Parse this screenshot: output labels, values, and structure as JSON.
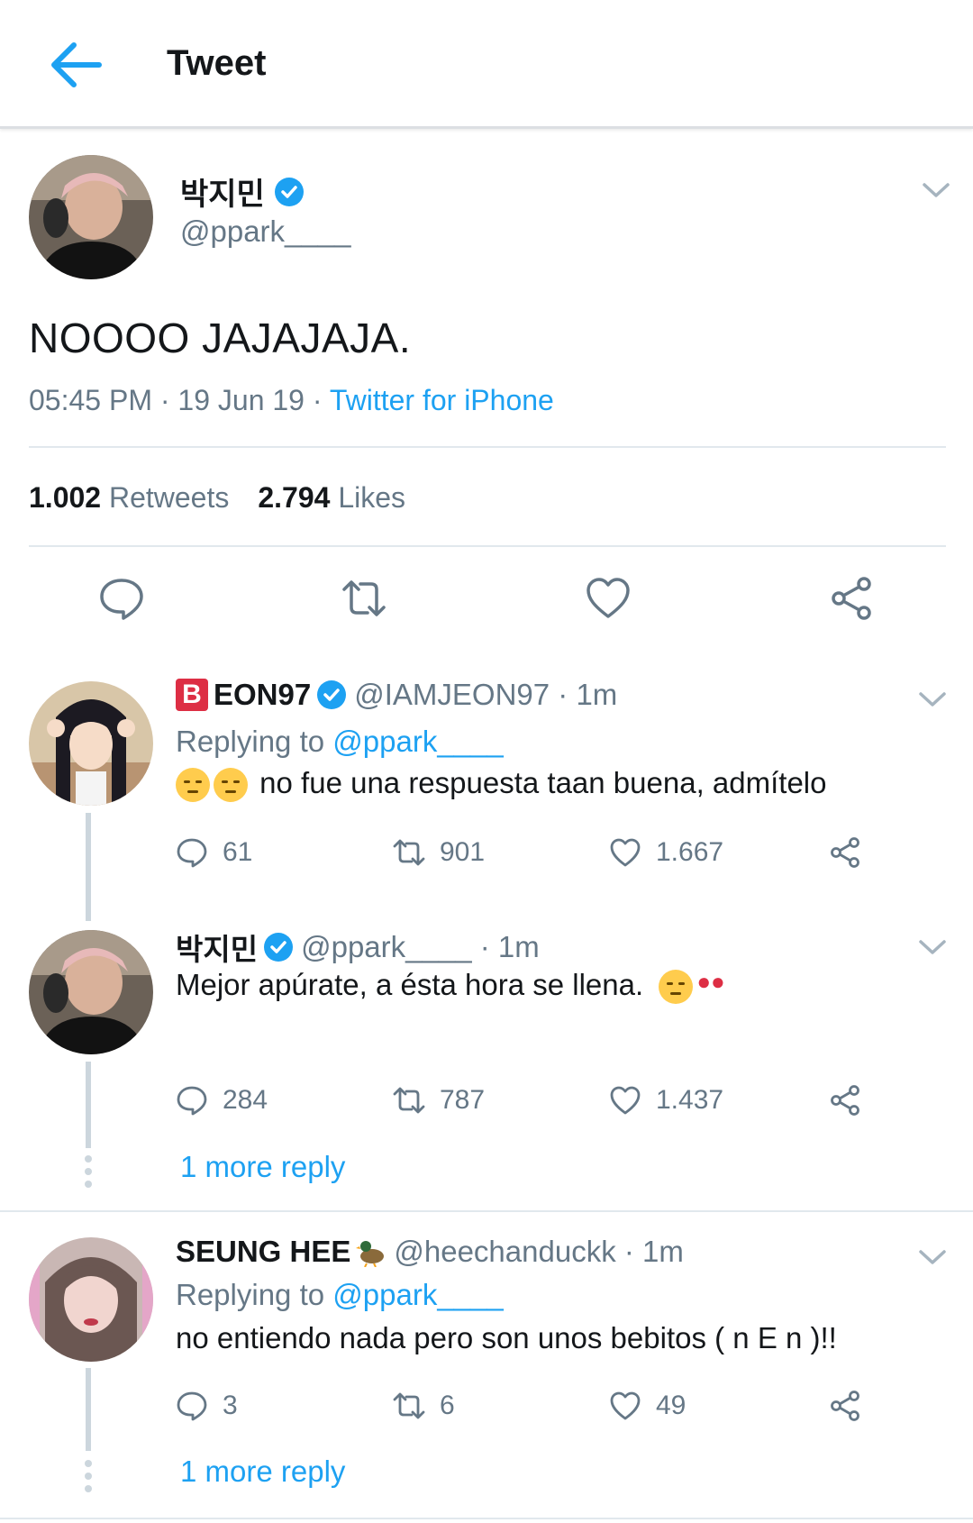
{
  "header": {
    "title": "Tweet"
  },
  "main_tweet": {
    "name": "박지민",
    "handle": "@ppark____",
    "text": "NOOOO JAJAJAJA.",
    "time": "05:45 PM · 19 Jun 19 · ",
    "source": "Twitter for iPhone",
    "retweets_count": "1.002",
    "retweets_label": "Retweets",
    "likes_count": "2.794",
    "likes_label": "Likes"
  },
  "replies": [
    {
      "name": "EON97",
      "handle": "@IAMJEON97",
      "time": "· 1m",
      "replying_label": "Replying to ",
      "replying_to": "@ppark____",
      "text": "no fue una respuesta taan buena, admítelo",
      "comments": "61",
      "retweets": "901",
      "likes": "1.667"
    },
    {
      "name": "박지민",
      "handle": "@ppark____",
      "time": "· 1m",
      "text": "Mejor apúrate, a ésta hora se llena.",
      "comments": "284",
      "retweets": "787",
      "likes": "1.437",
      "more_reply": "1 more reply"
    },
    {
      "name": "SEUNG HEE",
      "handle": "@heechanduckk",
      "time": "· 1m",
      "replying_label": "Replying to ",
      "replying_to": "@ppark____",
      "text": "no entiendo nada pero son unos bebitos ( n E n )!!",
      "comments": "3",
      "retweets": "6",
      "likes": "49",
      "more_reply": "1 more reply"
    }
  ],
  "colors": {
    "accent": "#1da1f2",
    "muted": "#657786",
    "text": "#14171a",
    "divider": "#e1e8ed"
  }
}
